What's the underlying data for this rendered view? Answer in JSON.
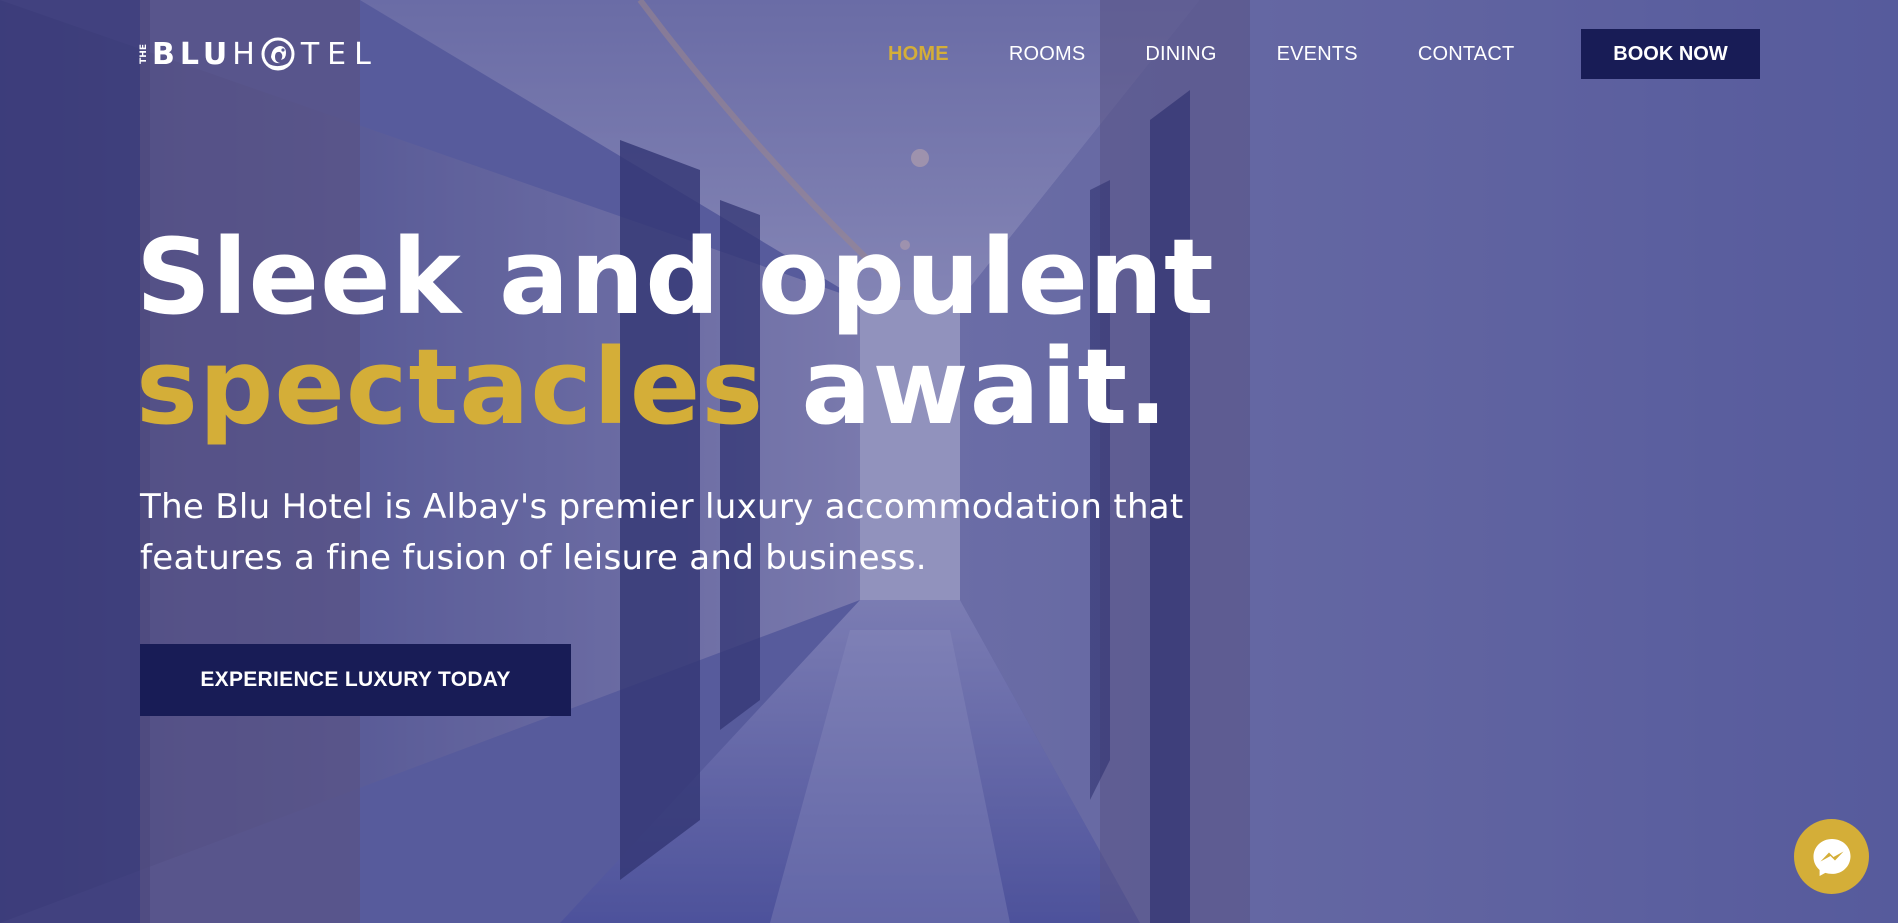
{
  "brand": {
    "logo_the": "THE",
    "logo_blu": "BLU",
    "logo_h": "H",
    "logo_tel": "TEL",
    "primary_color": "#181c56",
    "accent_color": "#d4ae38"
  },
  "nav": {
    "items": [
      {
        "label": "HOME",
        "active": true
      },
      {
        "label": "ROOMS",
        "active": false
      },
      {
        "label": "DINING",
        "active": false
      },
      {
        "label": "EVENTS",
        "active": false
      },
      {
        "label": "CONTACT",
        "active": false
      }
    ],
    "book_label": "BOOK NOW"
  },
  "hero": {
    "headline_line1": "Sleek and opulent",
    "headline_highlight": "spectacles",
    "headline_rest": " await.",
    "subtext": "The Blu Hotel is Albay's premier luxury accommodation that features a fine fusion of leisure and business.",
    "cta_label": "EXPERIENCE LUXURY TODAY"
  },
  "chat": {
    "icon": "messenger-icon"
  }
}
